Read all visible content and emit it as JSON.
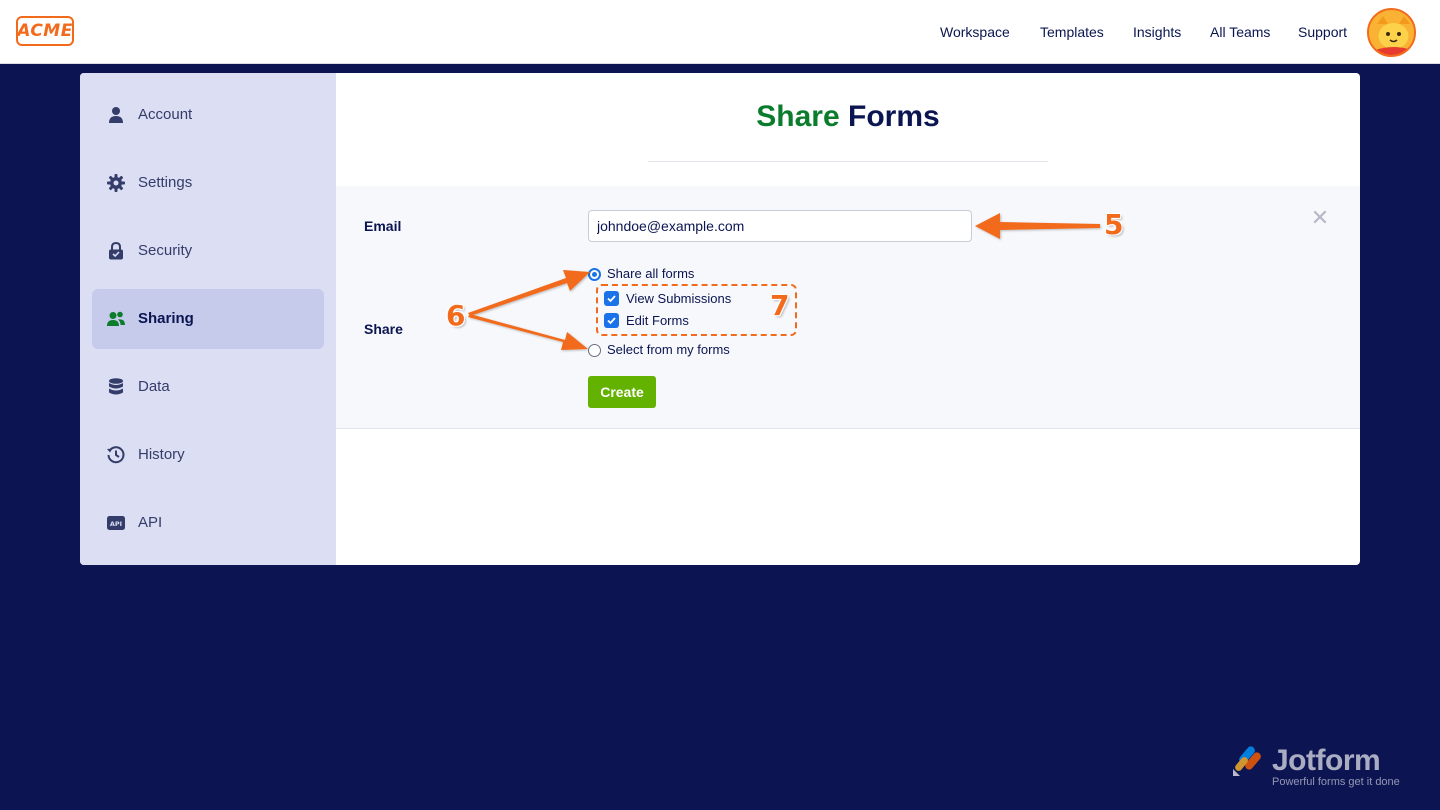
{
  "header": {
    "logo_text": "ACME",
    "nav": [
      "Workspace",
      "Templates",
      "Insights",
      "All Teams",
      "Support"
    ]
  },
  "sidebar": {
    "items": [
      {
        "label": "Account",
        "icon": "user-icon"
      },
      {
        "label": "Settings",
        "icon": "gear-icon"
      },
      {
        "label": "Security",
        "icon": "lock-icon"
      },
      {
        "label": "Sharing",
        "icon": "users-icon",
        "active": true
      },
      {
        "label": "Data",
        "icon": "database-icon"
      },
      {
        "label": "History",
        "icon": "history-icon"
      },
      {
        "label": "API",
        "icon": "api-icon"
      }
    ]
  },
  "main": {
    "title_accent": "Share",
    "title_rest": "Forms",
    "email_label": "Email",
    "email_value": "johndoe@example.com",
    "share_label": "Share",
    "options": {
      "share_all": "Share all forms",
      "view_submissions": "View Submissions",
      "edit_forms": "Edit Forms",
      "select_from": "Select from my forms"
    },
    "create_label": "Create"
  },
  "annotations": {
    "step_5": "5",
    "step_6": "6",
    "step_7": "7"
  },
  "brand": {
    "name": "Jotform",
    "tagline": "Powerful forms get it done"
  },
  "colors": {
    "background": "#0c1452",
    "accent_green": "#0a7c2c",
    "button_green": "#64b200",
    "annotation_orange": "#f26b1d",
    "checkbox_blue": "#1a73e8"
  }
}
